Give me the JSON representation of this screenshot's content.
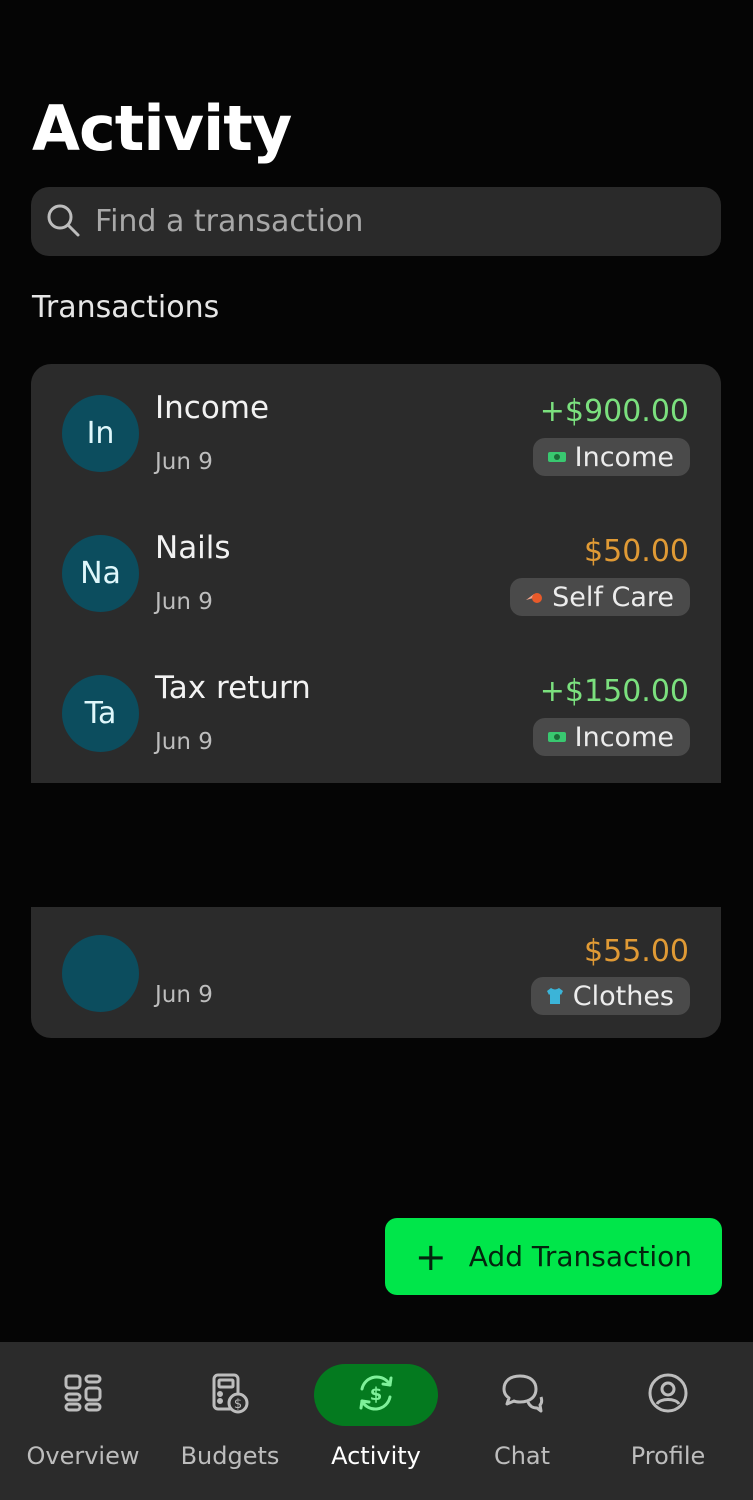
{
  "header": {
    "title": "Activity"
  },
  "search": {
    "placeholder": "Find a transaction"
  },
  "section": {
    "title": "Transactions"
  },
  "transactions": [
    {
      "initials": "In",
      "name": "Income",
      "date": "Jun 9",
      "amount": "+$900.00",
      "amount_type": "income",
      "category": "Income",
      "category_icon": "cash-icon"
    },
    {
      "initials": "Na",
      "name": "Nails",
      "date": "Jun 9",
      "amount": "$50.00",
      "amount_type": "expense",
      "category": "Self Care",
      "category_icon": "nail-polish-icon"
    },
    {
      "initials": "Ta",
      "name": "Tax return",
      "date": "Jun 9",
      "amount": "+$150.00",
      "amount_type": "income",
      "category": "Income",
      "category_icon": "cash-icon"
    },
    {
      "initials": "",
      "name": "",
      "date": "Jun 9",
      "amount": "$55.00",
      "amount_type": "expense",
      "category": "Clothes",
      "category_icon": "tshirt-icon"
    }
  ],
  "add_button": {
    "label": "Add Transaction"
  },
  "nav": {
    "items": [
      {
        "label": "Overview",
        "icon": "grid-icon"
      },
      {
        "label": "Budgets",
        "icon": "budget-icon"
      },
      {
        "label": "Activity",
        "icon": "dollar-cycle-icon",
        "active": true
      },
      {
        "label": "Chat",
        "icon": "chat-icon"
      },
      {
        "label": "Profile",
        "icon": "profile-icon"
      }
    ]
  },
  "colors": {
    "background": "#050505",
    "card": "#2b2b2b",
    "avatar": "#0c4d5e",
    "income": "#7be07e",
    "expense": "#e09a35",
    "accent": "#00e64a",
    "nav_active": "#047a1f"
  }
}
